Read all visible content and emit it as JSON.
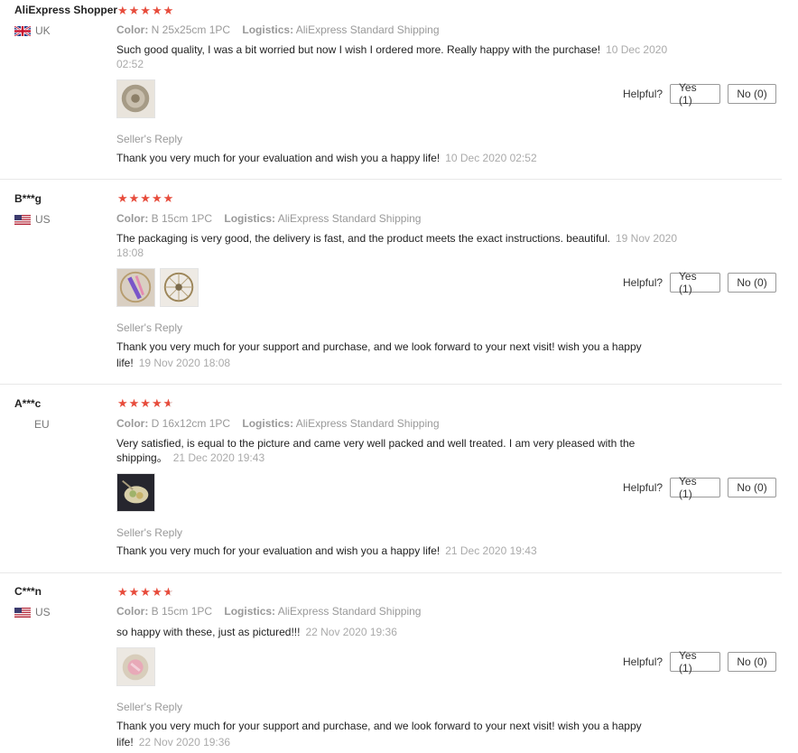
{
  "reviews": [
    {
      "user": "AliExpress Shopper",
      "country": "UK",
      "flag": "uk",
      "stars": "★★★★★",
      "color_label": "Color:",
      "color": "N 25x25cm 1PC",
      "logistics_label": "Logistics:",
      "logistics": "AliExpress Standard Shipping",
      "text": "Such good quality, I was a bit worried but now I wish I ordered more. Really happy with the purchase!",
      "date": "10 Dec 2020 02:52",
      "helpful_label": "Helpful?",
      "yes": "Yes (1)",
      "no": "No (0)",
      "reply_title": "Seller's Reply",
      "reply": "Thank you very much for your evaluation and wish you a happy life!",
      "reply_date": "10 Dec 2020 02:52"
    },
    {
      "user": "B***g",
      "country": "US",
      "flag": "us",
      "stars": "★★★★★",
      "color_label": "Color:",
      "color": "B 15cm 1PC",
      "logistics_label": "Logistics:",
      "logistics": "AliExpress Standard Shipping",
      "text": "The packaging is very good, the delivery is fast, and the product meets the exact instructions. beautiful.",
      "date": "19 Nov 2020 18:08",
      "helpful_label": "Helpful?",
      "yes": "Yes (1)",
      "no": "No (0)",
      "reply_title": "Seller's Reply",
      "reply": "Thank you very much for your support and purchase, and we look forward to your next visit! wish you a happy life!",
      "reply_date": "19 Nov 2020 18:08"
    },
    {
      "user": "A***c",
      "country": "EU",
      "flag": "",
      "stars": "★★★★",
      "color_label": "Color:",
      "color": "D 16x12cm 1PC",
      "logistics_label": "Logistics:",
      "logistics": "AliExpress Standard Shipping",
      "text": "Very satisfied, is equal to the picture and came very well packed and well treated. I am very pleased with the shipping。",
      "date": "21 Dec 2020 19:43",
      "helpful_label": "Helpful?",
      "yes": "Yes (1)",
      "no": "No (0)",
      "reply_title": "Seller's Reply",
      "reply": "Thank you very much for your evaluation and wish you a happy life!",
      "reply_date": "21 Dec 2020 19:43"
    },
    {
      "user": "C***n",
      "country": "US",
      "flag": "us",
      "stars": "★★★★",
      "color_label": "Color:",
      "color": "B 15cm 1PC",
      "logistics_label": "Logistics:",
      "logistics": "AliExpress Standard Shipping",
      "text": "so happy with these, just as pictured!!!",
      "date": "22 Nov 2020 19:36",
      "helpful_label": "Helpful?",
      "yes": "Yes (1)",
      "no": "No (0)",
      "reply_title": "Seller's Reply",
      "reply": "Thank you very much for your support and purchase, and we look forward to your next visit! wish you a happy life!",
      "reply_date": "22 Nov 2020 19:36"
    }
  ],
  "colors": {
    "star": "#e74c3c",
    "muted": "#999999",
    "border": "#e8e8e8"
  }
}
